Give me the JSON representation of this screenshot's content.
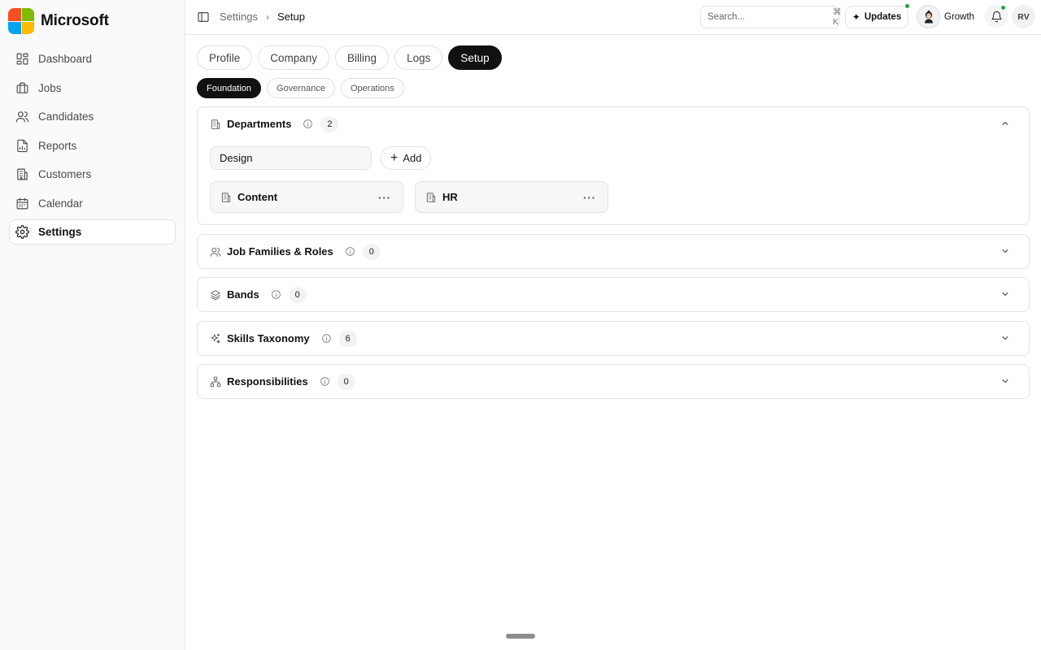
{
  "brand": {
    "name": "Microsoft",
    "logo_colors": [
      "#f25022",
      "#7fba00",
      "#00a4ef",
      "#ffb900"
    ]
  },
  "sidebar": {
    "items": [
      {
        "label": "Dashboard",
        "icon": "dashboard-icon",
        "active": false
      },
      {
        "label": "Jobs",
        "icon": "briefcase-icon",
        "active": false
      },
      {
        "label": "Candidates",
        "icon": "users-icon",
        "active": false
      },
      {
        "label": "Reports",
        "icon": "report-icon",
        "active": false
      },
      {
        "label": "Customers",
        "icon": "building-icon",
        "active": false
      },
      {
        "label": "Calendar",
        "icon": "calendar-icon",
        "active": false
      },
      {
        "label": "Settings",
        "icon": "gear-icon",
        "active": true
      }
    ]
  },
  "topbar": {
    "breadcrumb": [
      "Settings",
      "Setup"
    ],
    "search_placeholder": "Search...",
    "search_shortcut": "⌘ K",
    "updates_label": "Updates",
    "workspace_name": "Growth",
    "user_initials": "RV",
    "status_color": "#22a04b"
  },
  "tabs": [
    {
      "label": "Profile",
      "active": false
    },
    {
      "label": "Company",
      "active": false
    },
    {
      "label": "Billing",
      "active": false
    },
    {
      "label": "Logs",
      "active": false
    },
    {
      "label": "Setup",
      "active": true
    }
  ],
  "subtabs": [
    {
      "label": "Foundation",
      "active": true
    },
    {
      "label": "Governance",
      "active": false
    },
    {
      "label": "Operations",
      "active": false
    }
  ],
  "sections": {
    "departments": {
      "title": "Departments",
      "count": "2",
      "expanded": true,
      "input_value": "Design",
      "add_label": "Add",
      "items": [
        {
          "name": "Content",
          "more": "···"
        },
        {
          "name": "HR",
          "more": "···"
        }
      ]
    },
    "job_families": {
      "title": "Job Families & Roles",
      "count": "0",
      "expanded": false
    },
    "bands": {
      "title": "Bands",
      "count": "0",
      "expanded": false
    },
    "skills": {
      "title": "Skills Taxonomy",
      "count": "6",
      "expanded": false
    },
    "responsibilities": {
      "title": "Responsibilities",
      "count": "0",
      "expanded": false
    }
  }
}
